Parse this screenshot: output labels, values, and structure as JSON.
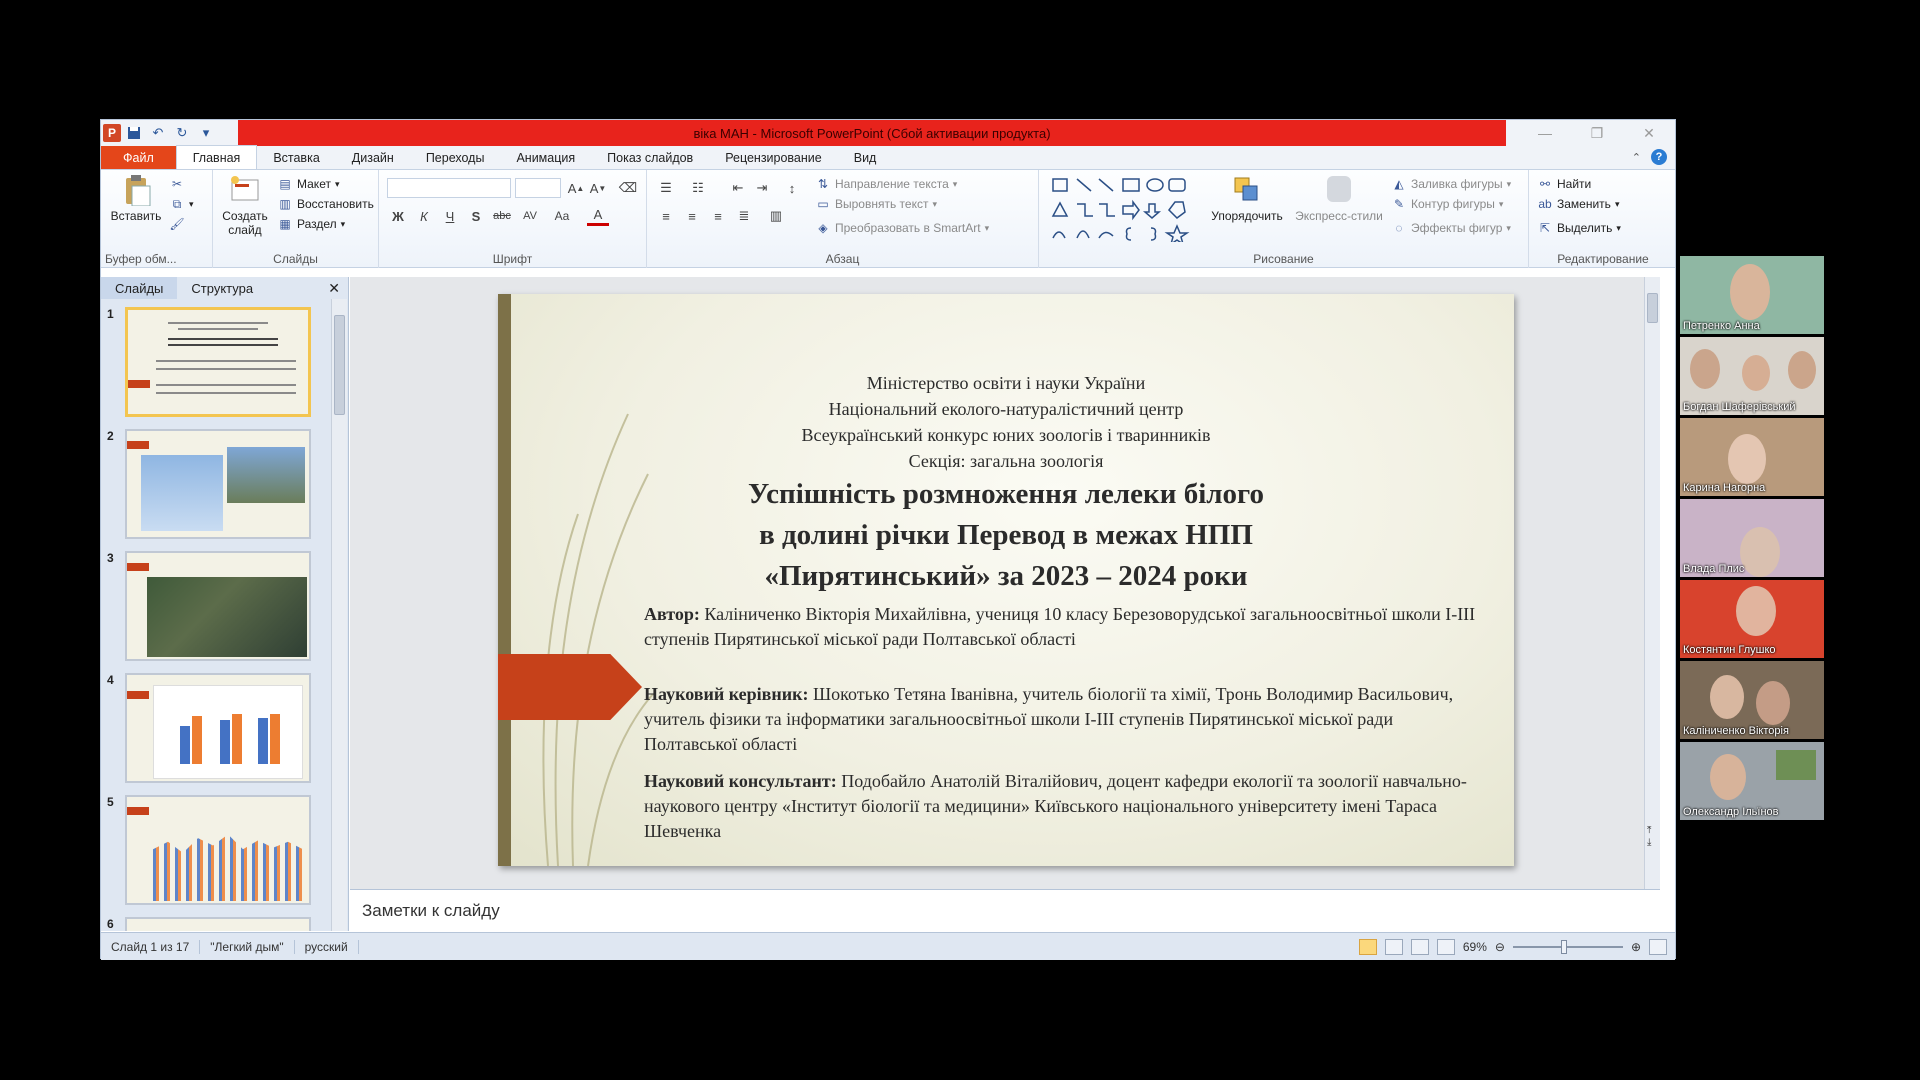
{
  "window": {
    "title": "віка МАН  -  Microsoft PowerPoint (Сбой активации продукта)"
  },
  "ribbon_tabs": [
    "Файл",
    "Главная",
    "Вставка",
    "Дизайн",
    "Переходы",
    "Анимация",
    "Показ слайдов",
    "Рецензирование",
    "Вид"
  ],
  "ribbon": {
    "clipboard": {
      "paste": "Вставить",
      "label": "Буфер обм..."
    },
    "slides": {
      "new_slide": "Создать слайд",
      "layout": "Макет",
      "reset": "Восстановить",
      "section": "Раздел",
      "label": "Слайды"
    },
    "font": {
      "label": "Шрифт",
      "bold": "Ж",
      "italic": "К",
      "underline": "Ч",
      "strike": "S",
      "shadow": "abc",
      "spacing": "AV",
      "case": "Aa",
      "color": "A"
    },
    "paragraph": {
      "label": "Абзац",
      "text_direction": "Направление текста",
      "align_text": "Выровнять текст",
      "smartart": "Преобразовать в SmartArt"
    },
    "drawing": {
      "label": "Рисование",
      "arrange": "Упорядочить",
      "quick_styles": "Экспресс-стили",
      "fill": "Заливка фигуры",
      "outline": "Контур фигуры",
      "effects": "Эффекты фигур"
    },
    "editing": {
      "label": "Редактирование",
      "find": "Найти",
      "replace": "Заменить",
      "select": "Выделить"
    }
  },
  "left_panel": {
    "tab_slides": "Слайды",
    "tab_outline": "Структура",
    "thumbnails": [
      {
        "num": "1"
      },
      {
        "num": "2"
      },
      {
        "num": "3"
      },
      {
        "num": "4"
      },
      {
        "num": "5"
      },
      {
        "num": "6"
      }
    ]
  },
  "slide": {
    "header": [
      "Міністерство освіти і науки України",
      "Національний еколого-натуралістичний центр",
      "Всеукраїнський конкурс юних зоологів і тваринників",
      "Секція: загальна зоологія"
    ],
    "title": [
      "Успішність розмноження лелеки білого",
      "в долині річки Перевод в межах НПП",
      "«Пирятинський» за 2023 – 2024 роки"
    ],
    "author_label": "Автор:",
    "author_text": " Каліниченко Вікторія Михайлівна, учениця 10 класу Березоворудської загальноосвітньої школи І-ІІІ ступенів Пирятинської міської ради Полтавської області",
    "supervisor_label": "Науковий керівник:",
    "supervisor_text": " Шокотько Тетяна Іванівна, учитель біології та хімії,   Тронь Володимир Васильович, учитель фізики та інформатики загальноосвітньої  школи І-ІІІ ступенів Пирятинської міської ради Полтавської області",
    "consultant_label": "Науковий консультант:",
    "consultant_text": " Подобайло Анатолій Віталійович, доцент кафедри екології та зоології  навчально-наукового центру «Інститут біології  та медицини» Київського національного  університету імені  Тараса Шевченка"
  },
  "notes_placeholder": "Заметки к слайду",
  "status": {
    "slide_of": "Слайд 1 из 17",
    "theme": "\"Легкий дым\"",
    "language": "русский",
    "zoom": "69%"
  },
  "participants": [
    {
      "name": "Петренко Анна",
      "bg": "#8fb7a3"
    },
    {
      "name": "Богдан Шаферівський",
      "bg": "#d9d4cc"
    },
    {
      "name": "Карина Нагорна",
      "bg": "#b89a7c"
    },
    {
      "name": "Влада Плис",
      "bg": "#c9b3c7"
    },
    {
      "name": "Костянтин Глушко",
      "bg": "#d8432d"
    },
    {
      "name": "Каліниченко Вікторія",
      "bg": "#7b6a57"
    },
    {
      "name": "Олександр Ільїнов",
      "bg": "#9aa2a8"
    }
  ],
  "colors": {
    "title_bar_red": "#e8231c",
    "file_tab": "#e4461a",
    "accent_shape": "#c6411a"
  }
}
